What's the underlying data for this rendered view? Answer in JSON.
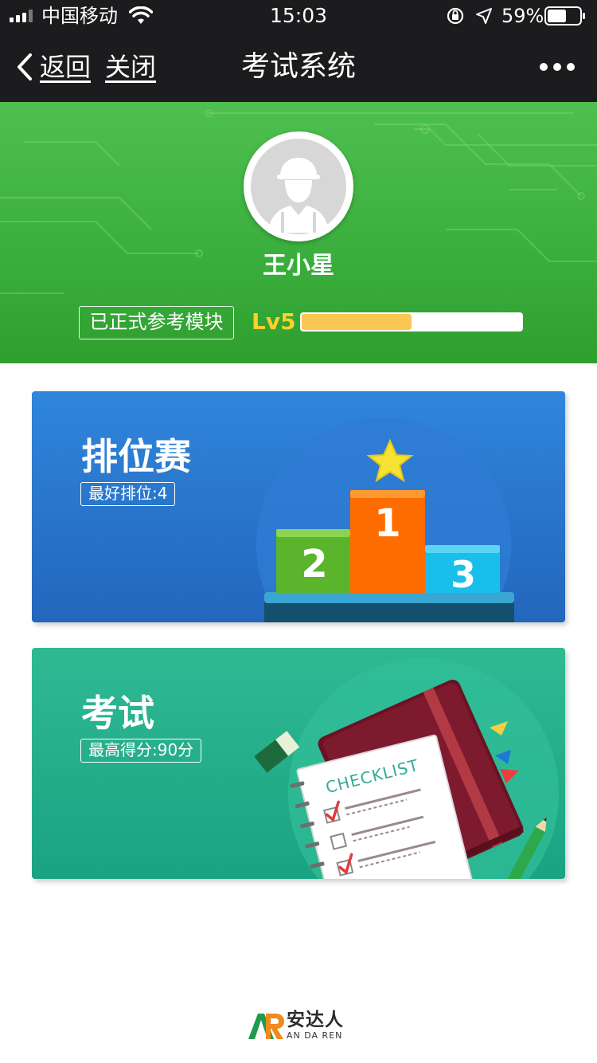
{
  "status_bar": {
    "carrier": "中国移动",
    "time": "15:03",
    "battery_percent": "59%",
    "battery_level": 0.59,
    "icons": [
      "signal-icon",
      "wifi-icon",
      "orientation-lock-icon",
      "location-arrow-icon",
      "battery-icon"
    ]
  },
  "nav": {
    "back_label": "返回",
    "close_label": "关闭",
    "title": "考试系统",
    "icons": [
      "chevron-left-icon",
      "more-icon"
    ]
  },
  "profile": {
    "name": "王小星",
    "module_badge": "已正式参考模块",
    "level": "Lv5",
    "level_progress": 0.5,
    "colors": {
      "header_green": "#3aae3c",
      "level_text": "#ffd02a",
      "level_fill": "#f9c752"
    }
  },
  "cards": {
    "rank": {
      "title": "排位赛",
      "subtitle": "最好排位:4",
      "podium": {
        "first": "1",
        "second": "2",
        "third": "3"
      },
      "color": "#2a78cf"
    },
    "exam": {
      "title": "考试",
      "subtitle": "最高得分:90分",
      "checklist_label": "CHECKLIST",
      "color": "#22af8b"
    }
  },
  "footer": {
    "brand": "安达人",
    "brand_en": "AN DA REN",
    "logo_letters": "AR"
  }
}
